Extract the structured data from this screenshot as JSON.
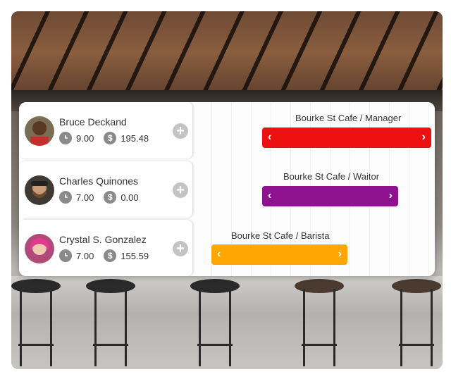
{
  "employees": [
    {
      "name": "Bruce Deckand",
      "hours": "9.00",
      "pay": "195.48",
      "shift": "Bourke St Cafe / Manager",
      "color": "#ee1111"
    },
    {
      "name": "Charles Quinones",
      "hours": "7.00",
      "pay": "0.00",
      "shift": "Bourke St Cafe / Waitor",
      "color": "#8e128e"
    },
    {
      "name": "Crystal S. Gonzalez",
      "hours": "7.00",
      "pay": "155.59",
      "shift": "Bourke St Cafe / Barista",
      "color": "#ffa600"
    }
  ],
  "icons": {
    "clock": "clock-icon",
    "dollar": "dollar-icon",
    "add": "plus-icon",
    "prev": "chevron-left-icon",
    "next": "chevron-right-icon"
  },
  "glyphs": {
    "dollar": "$",
    "plus": "+",
    "prev": "‹",
    "next": "›"
  }
}
